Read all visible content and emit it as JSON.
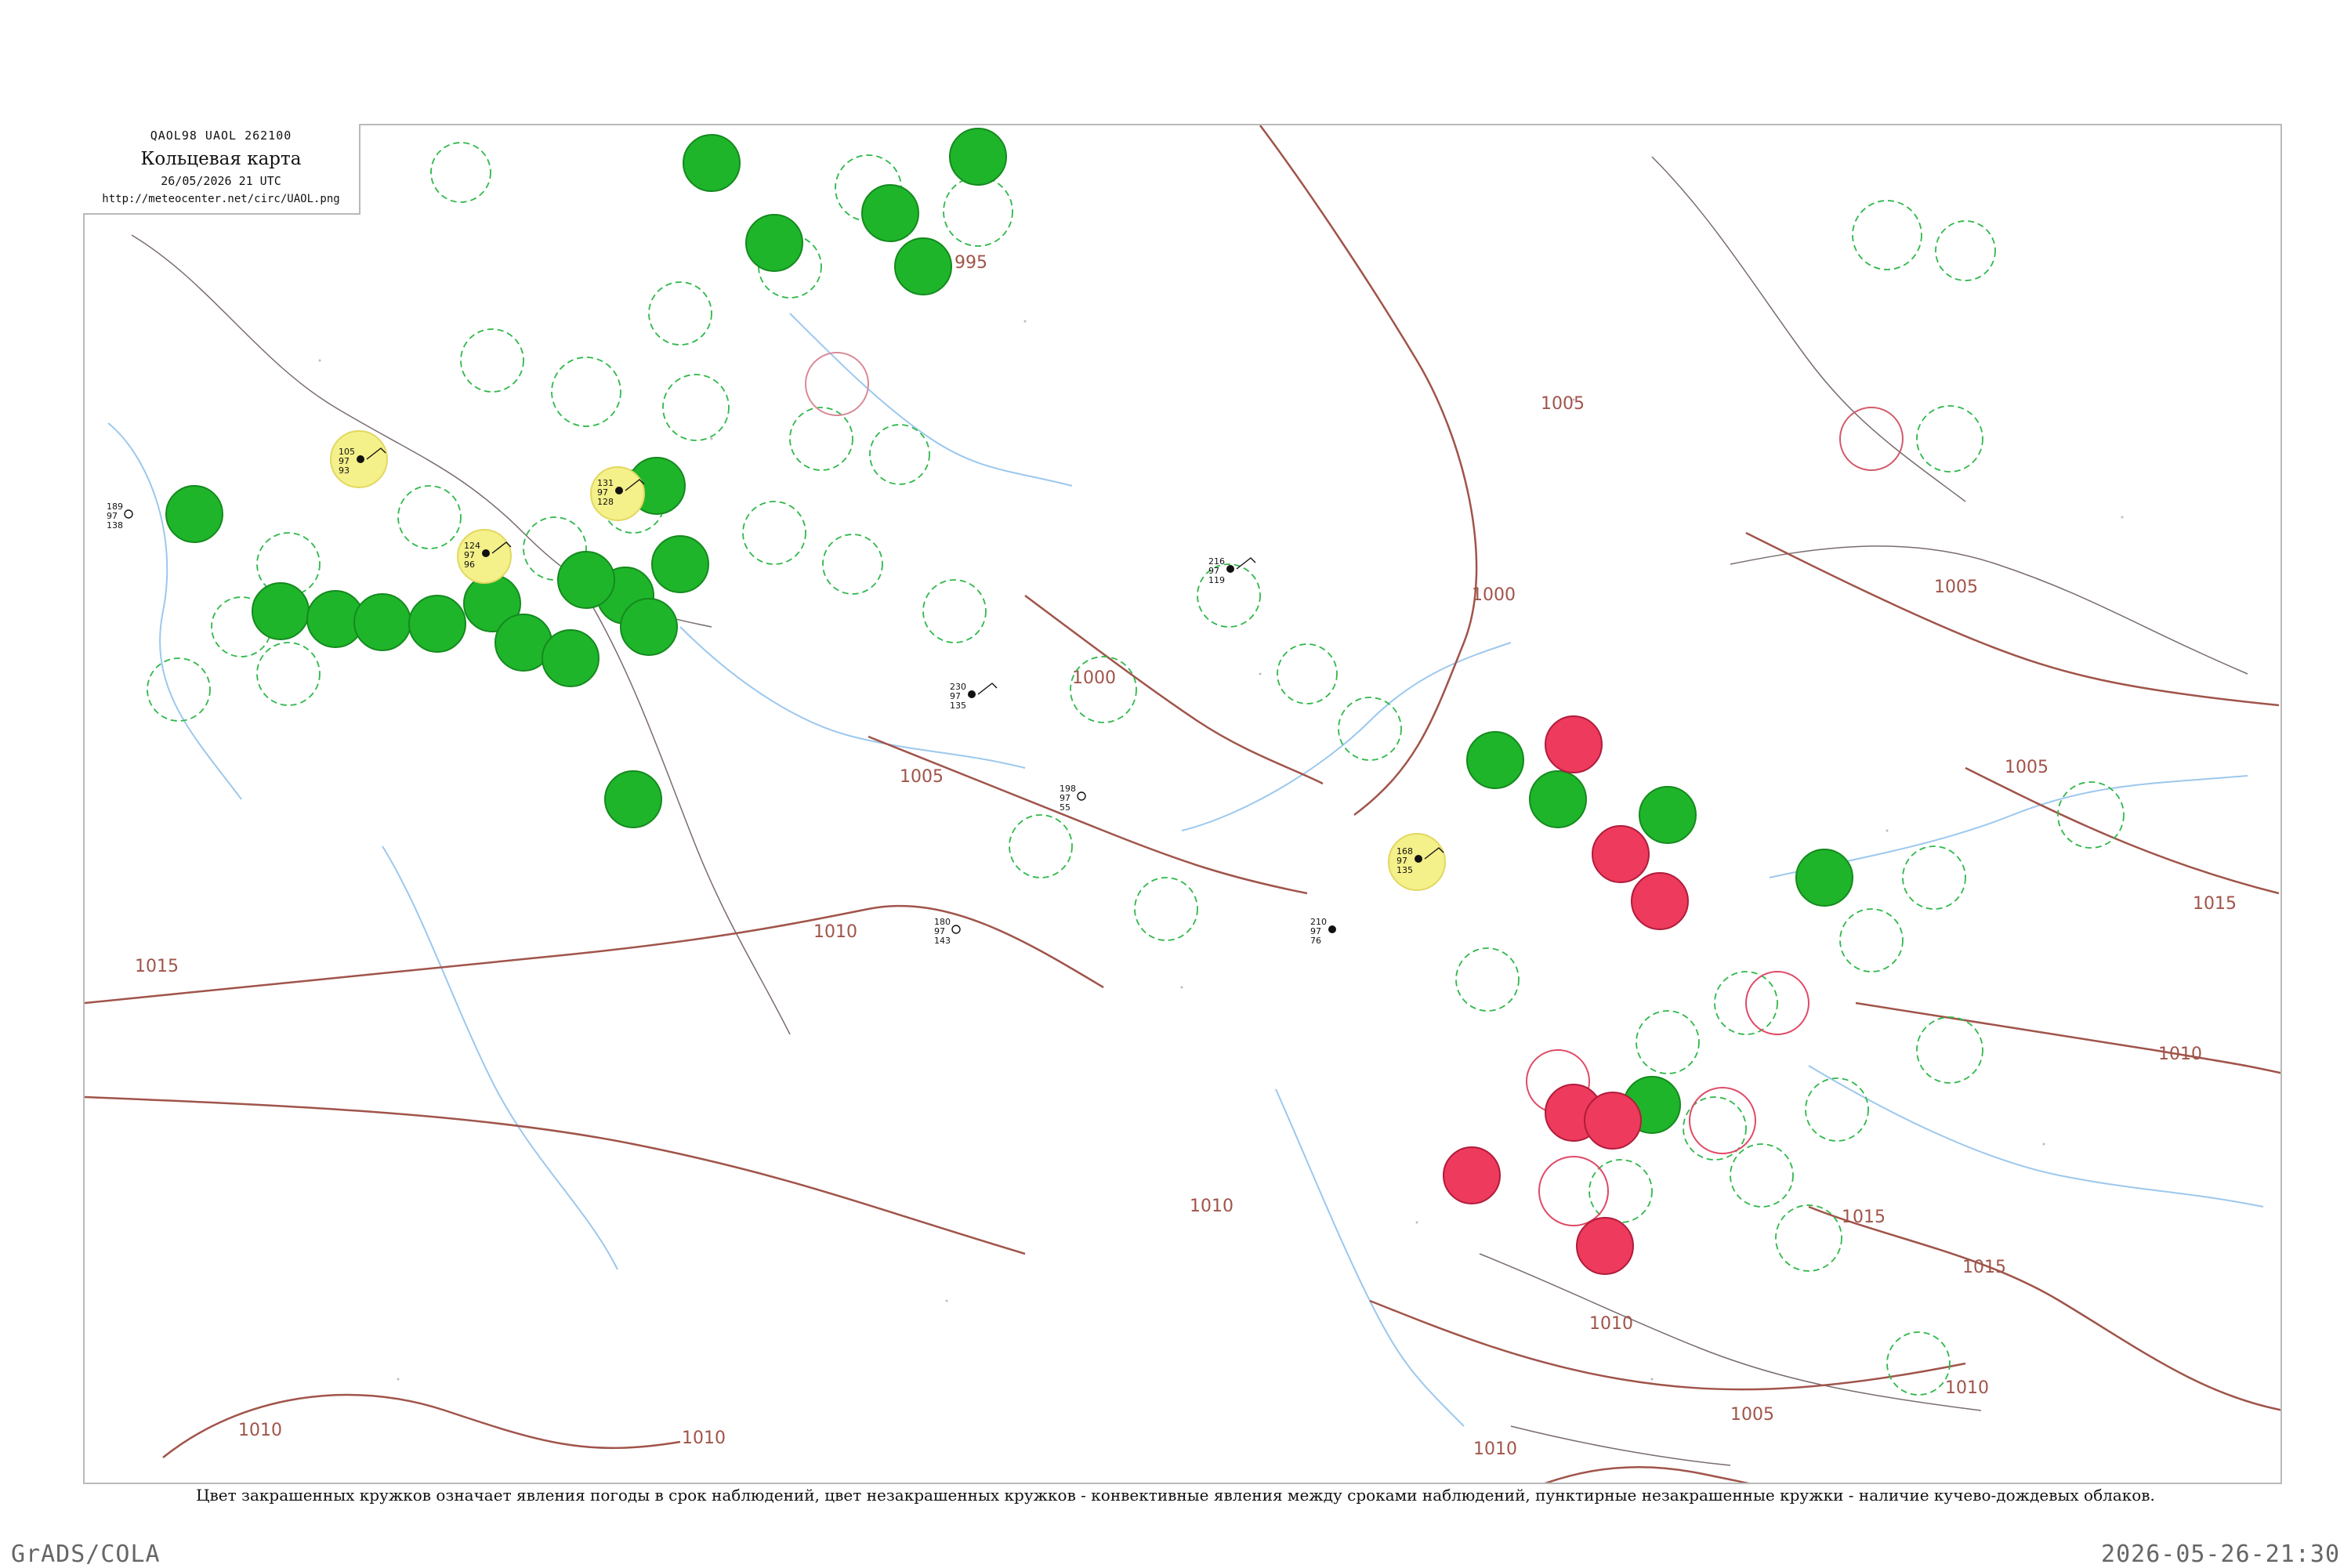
{
  "header": {
    "code": "QAOL98  UAOL  262100",
    "title": "Кольцевая карта",
    "date": "26/05/2026 21 UTC",
    "url": "http://meteocenter.net/circ/UAOL.png"
  },
  "footer": {
    "note": "Цвет закрашенных кружков означает явления погоды в срок наблюдений, цвет незакрашенных кружков - конвективные явления между сроками наблюдений, пунктирные незакрашенные кружки - наличие кучево-дождевых облаков.",
    "credit": "GrADS/COLA",
    "timestamp": "2026-05-26-21:30"
  },
  "colors": {
    "isobar": "#a0544a",
    "river": "#9cc8ee",
    "filled_green": "#1fb52b",
    "filled_red": "#ee3a5c",
    "filled_yellow": "#f4f08a",
    "dashed_ring": "#2fb84a",
    "frame": "#b9b9b9"
  },
  "isobar_labels": [
    {
      "text": "995"
    },
    {
      "text": "1000"
    },
    {
      "text": "1000"
    },
    {
      "text": "1005"
    },
    {
      "text": "1005"
    },
    {
      "text": "1005"
    },
    {
      "text": "1005"
    },
    {
      "text": "1005"
    },
    {
      "text": "1010"
    },
    {
      "text": "1010"
    },
    {
      "text": "1010"
    },
    {
      "text": "1010"
    },
    {
      "text": "1010"
    },
    {
      "text": "1010"
    },
    {
      "text": "1010"
    },
    {
      "text": "1010"
    },
    {
      "text": "1015"
    },
    {
      "text": "1015"
    },
    {
      "text": "1015"
    },
    {
      "text": "1015"
    }
  ],
  "stations": [
    {
      "t": "105",
      "p": "97",
      "d": "93"
    },
    {
      "t": "124",
      "p": "97",
      "d": "96"
    },
    {
      "t": "131",
      "p": "97",
      "d": "128"
    },
    {
      "t": "189",
      "p": "97",
      "d": "138"
    },
    {
      "t": "168",
      "p": "97",
      "d": "135"
    },
    {
      "t": "216",
      "p": "97",
      "d": "119"
    },
    {
      "t": "230",
      "p": "97",
      "d": "135"
    },
    {
      "t": "198",
      "p": "97",
      "d": "55"
    },
    {
      "t": "180",
      "p": "97",
      "d": "143"
    },
    {
      "t": "210",
      "p": "97",
      "d": "76"
    }
  ]
}
